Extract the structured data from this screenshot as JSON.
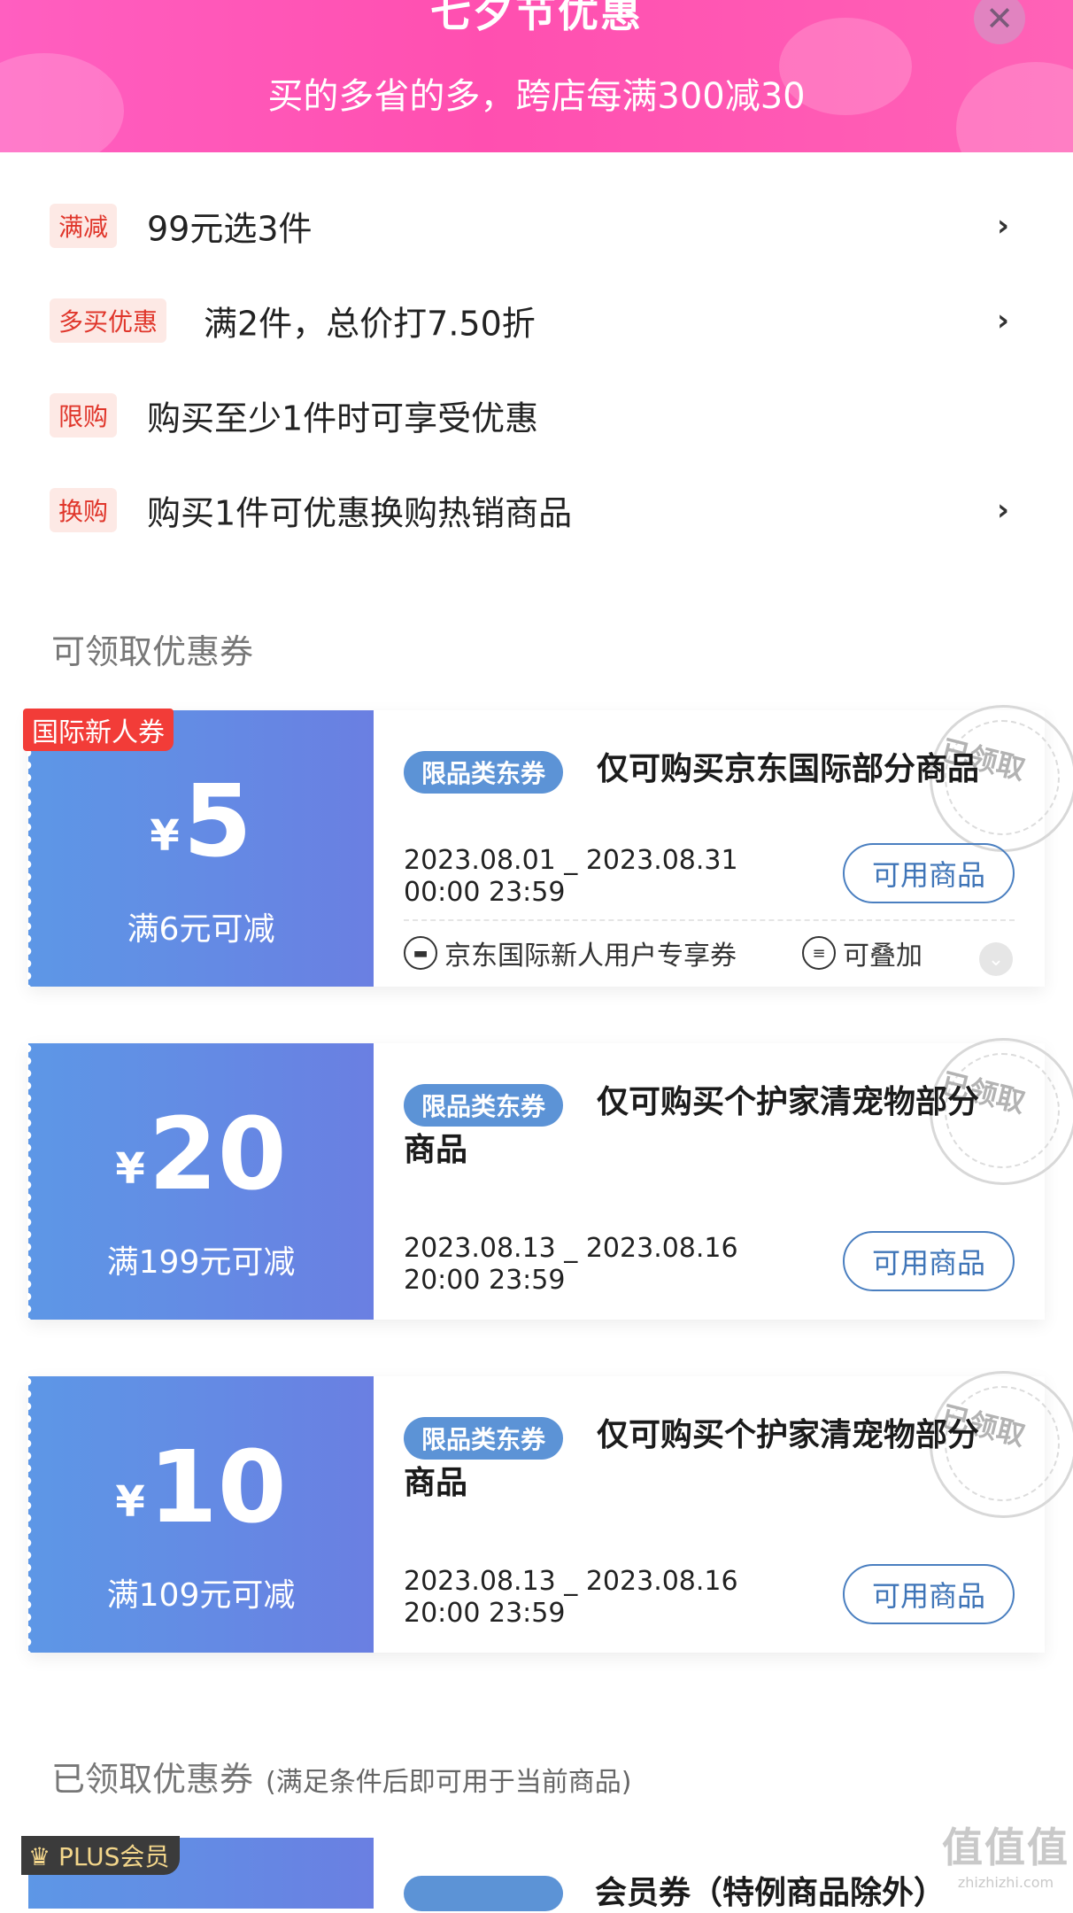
{
  "header": {
    "title": "七夕节优惠",
    "subtitle": "买的多省的多，跨店每满300减30",
    "close_icon": "close-icon"
  },
  "promotions": [
    {
      "tag": "满减",
      "text": "99元选3件",
      "has_arrow": true
    },
    {
      "tag": "多买优惠",
      "text": "满2件，总价打7.50折",
      "has_arrow": true
    },
    {
      "tag": "限购",
      "text": "购买至少1件时可享受优惠",
      "has_arrow": false
    },
    {
      "tag": "换购",
      "text": "购买1件可优惠换购热销商品",
      "has_arrow": true
    }
  ],
  "available_section": {
    "title": "可领取优惠券"
  },
  "coupons": [
    {
      "ribbon": "国际新人券",
      "currency": "¥",
      "amount": "5",
      "condition": "满6元可减",
      "category_tag": "限品类东券",
      "title": "仅可购买京东国际部分商品",
      "date_range": "2023.08.01 _ 2023.08.31",
      "time_range": "00:00 23:59",
      "button": "可用商品",
      "stamp": "已领取",
      "features": [
        "京东国际新人用户专享券",
        "可叠加"
      ]
    },
    {
      "currency": "¥",
      "amount": "20",
      "condition": "满199元可减",
      "category_tag": "限品类东券",
      "title": "仅可购买个护家清宠物部分商品",
      "date_range": "2023.08.13 _ 2023.08.16",
      "time_range": "20:00 23:59",
      "button": "可用商品",
      "stamp": "已领取"
    },
    {
      "currency": "¥",
      "amount": "10",
      "condition": "满109元可减",
      "category_tag": "限品类东券",
      "title": "仅可购买个护家清宠物部分商品",
      "date_range": "2023.08.13 _ 2023.08.16",
      "time_range": "20:00 23:59",
      "button": "可用商品",
      "stamp": "已领取"
    }
  ],
  "received_section": {
    "title": "已领取优惠券",
    "note": "(满足条件后即可用于当前商品)"
  },
  "plus_coupon": {
    "badge": "PLUS会员",
    "title_partial": "会员券（特例商品除外）"
  },
  "watermark": {
    "big": "值值值",
    "small": "zhizhizhi.com"
  },
  "colors": {
    "banner": "#ff4fb0",
    "coupon_blue": "#5d97e6",
    "promo_tag_red": "#e0362b",
    "ribbon_red": "#f23c38",
    "button_blue": "#3f75b8"
  }
}
